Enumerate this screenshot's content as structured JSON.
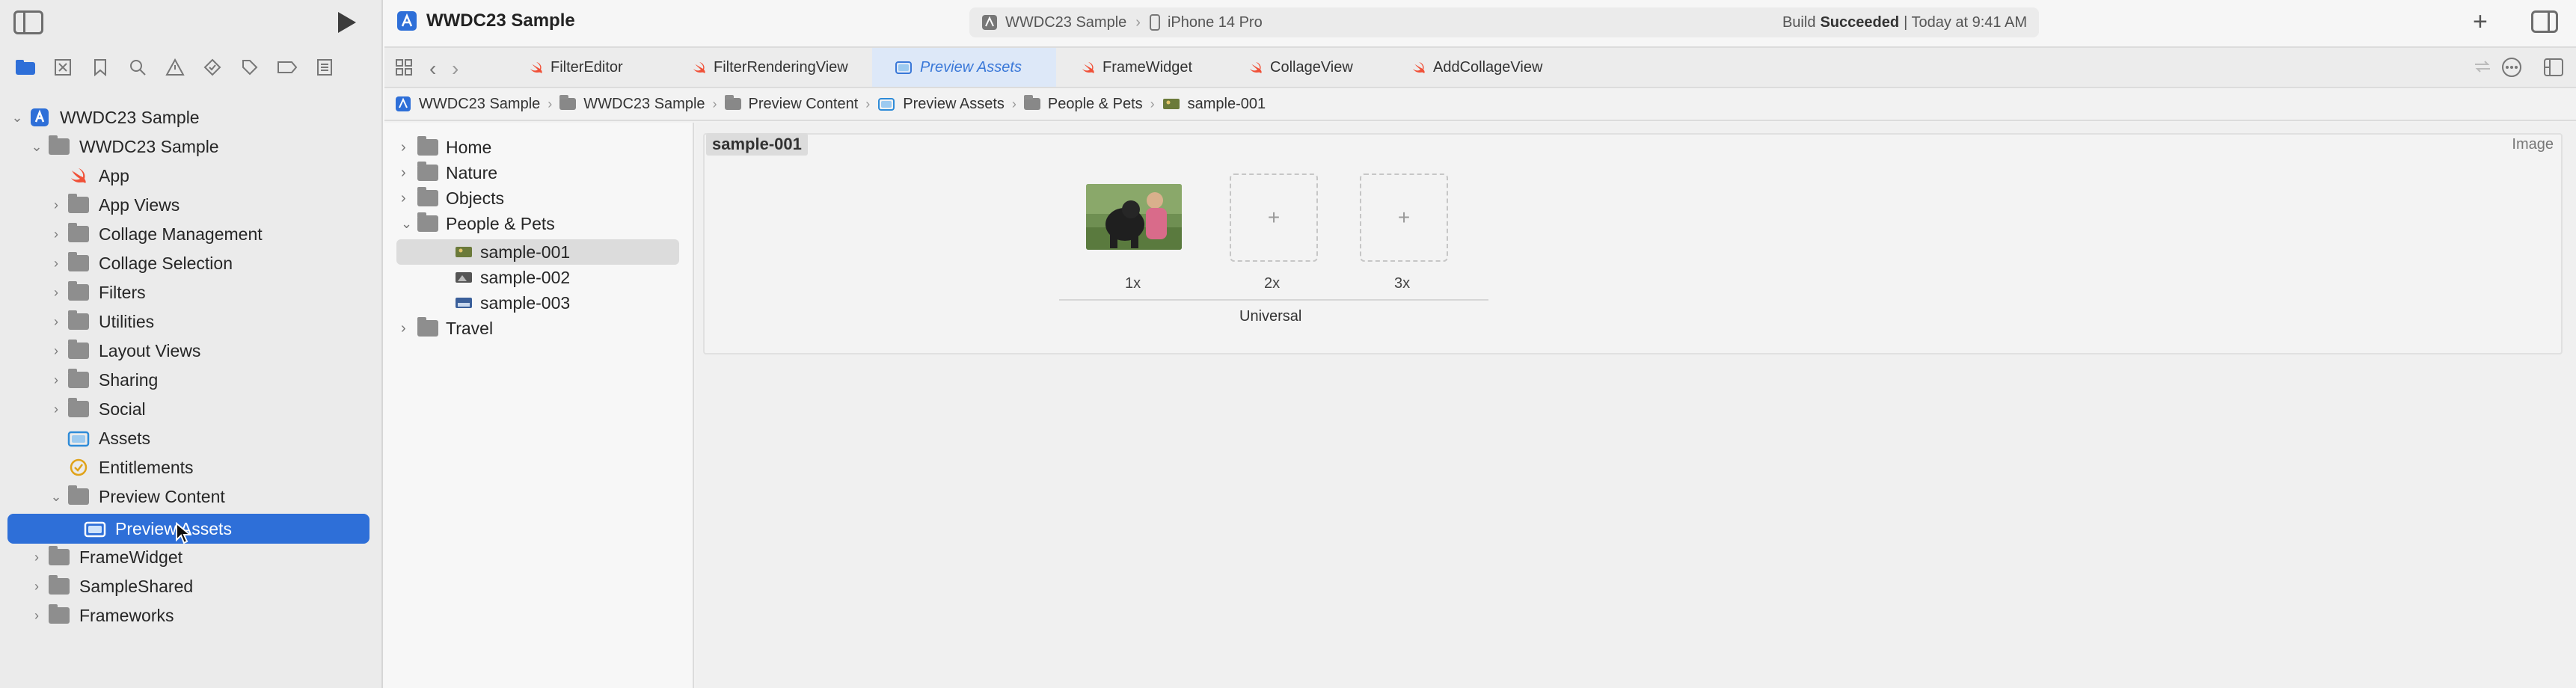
{
  "window": {
    "title": "WWDC23 Sample"
  },
  "scheme": {
    "project": "WWDC23 Sample",
    "device": "iPhone 14 Pro"
  },
  "status": {
    "prefix": "Build",
    "bold": "Succeeded",
    "time": "| Today at 9:41 AM"
  },
  "navigator": {
    "tabs": [
      "folder-icon",
      "x-square-icon",
      "bookmark-icon",
      "search-icon",
      "warning-icon",
      "diamond-icon",
      "tag-icon",
      "breakpoint-icon",
      "report-icon"
    ],
    "root": "WWDC23 Sample",
    "group": "WWDC23 Sample",
    "items": [
      "App",
      "App Views",
      "Collage Management",
      "Collage Selection",
      "Filters",
      "Utilities",
      "Layout Views",
      "Sharing",
      "Social",
      "Assets",
      "Entitlements",
      "Preview Content",
      "Preview Assets",
      "FrameWidget",
      "SampleShared",
      "Frameworks"
    ]
  },
  "tabs": [
    "FilterEditor",
    "FilterRenderingView",
    "Preview Assets",
    "FrameWidget",
    "CollageView",
    "AddCollageView"
  ],
  "jumpbar": [
    "WWDC23 Sample",
    "WWDC23 Sample",
    "Preview Content",
    "Preview Assets",
    "People & Pets",
    "sample-001"
  ],
  "assets": {
    "folders": [
      "Home",
      "Nature",
      "Objects",
      "People & Pets",
      "Travel"
    ],
    "children": [
      "sample-001",
      "sample-002",
      "sample-003"
    ]
  },
  "detail": {
    "name": "sample-001",
    "kind": "Image",
    "slots": [
      "1x",
      "2x",
      "3x"
    ],
    "group": "Universal"
  },
  "colors": {
    "accent": "#2e6fd8",
    "swift": "#f05138"
  }
}
